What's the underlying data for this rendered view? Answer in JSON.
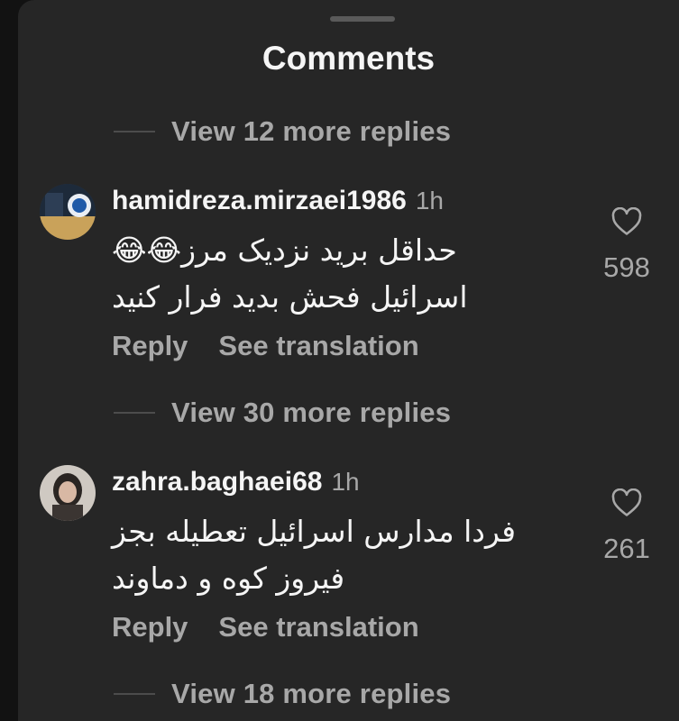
{
  "header": {
    "title": "Comments"
  },
  "thread": [
    {
      "view_more": "View 12 more replies"
    },
    {
      "comment": {
        "username": "hamidreza.mirzaei1986",
        "time": "1h",
        "text_line1": "حداقل برید نزدیک مرز😂😂",
        "text_line2": "اسرائیل فحش بدید فرار کنید",
        "reply_label": "Reply",
        "translate_label": "See translation",
        "likes": "598"
      }
    },
    {
      "view_more": "View 30 more replies"
    },
    {
      "comment": {
        "username": "zahra.baghaei68",
        "time": "1h",
        "text_line1": "فردا مدارس اسرائیل تعطیله بجز",
        "text_line2": "فیروز کوه و دماوند",
        "reply_label": "Reply",
        "translate_label": "See translation",
        "likes": "261"
      }
    },
    {
      "view_more": "View 18 more replies"
    }
  ],
  "icons": {
    "like": "heart-outline-icon"
  },
  "colors": {
    "background": "#262626",
    "text": "#f5f5f5",
    "muted": "#a8a8a8"
  }
}
